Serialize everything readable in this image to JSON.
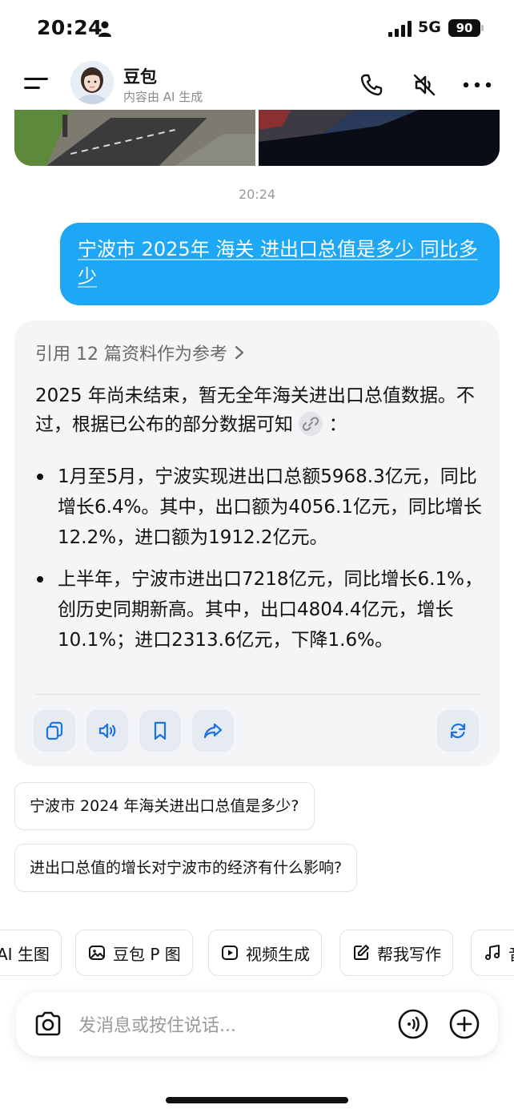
{
  "status_bar": {
    "time": "20:24",
    "network": "5G",
    "battery": "90"
  },
  "header": {
    "bot_name": "豆包",
    "subtitle": "内容由 AI 生成"
  },
  "timestamp": "20:24",
  "user_message": "宁波市 2025年 海关 进出口总值是多少 同比多少",
  "answer": {
    "reference": "引用 12 篇资料作为参考",
    "intro": "2025 年尚未结束，暂无全年海关进出口总值数据。不过，根据已公布的部分数据可知",
    "intro_end": "：",
    "bullets": [
      "1月至5月，宁波实现进出口总额5968.3亿元，同比增长6.4%。其中，出口额为4056.1亿元，同比增长12.2%，进口额为1912.2亿元。",
      "上半年，宁波市进出口7218亿元，同比增长6.1%，创历史同期新高。其中，出口4804.4亿元，增长10.1%；进口2313.6亿元，下降1.6%。"
    ]
  },
  "suggestions": [
    "宁波市 2024 年海关进出口总值是多少?",
    "进出口总值的增长对宁波市的经济有什么影响?"
  ],
  "chips": [
    "AI 生图",
    "豆包 P 图",
    "视频生成",
    "帮我写作",
    "音"
  ],
  "input": {
    "placeholder": "发消息或按住说话..."
  },
  "colors": {
    "user_bubble": "#1ea7f5",
    "action_icon": "#1a73e8",
    "card_bg": "#f4f5f7"
  }
}
